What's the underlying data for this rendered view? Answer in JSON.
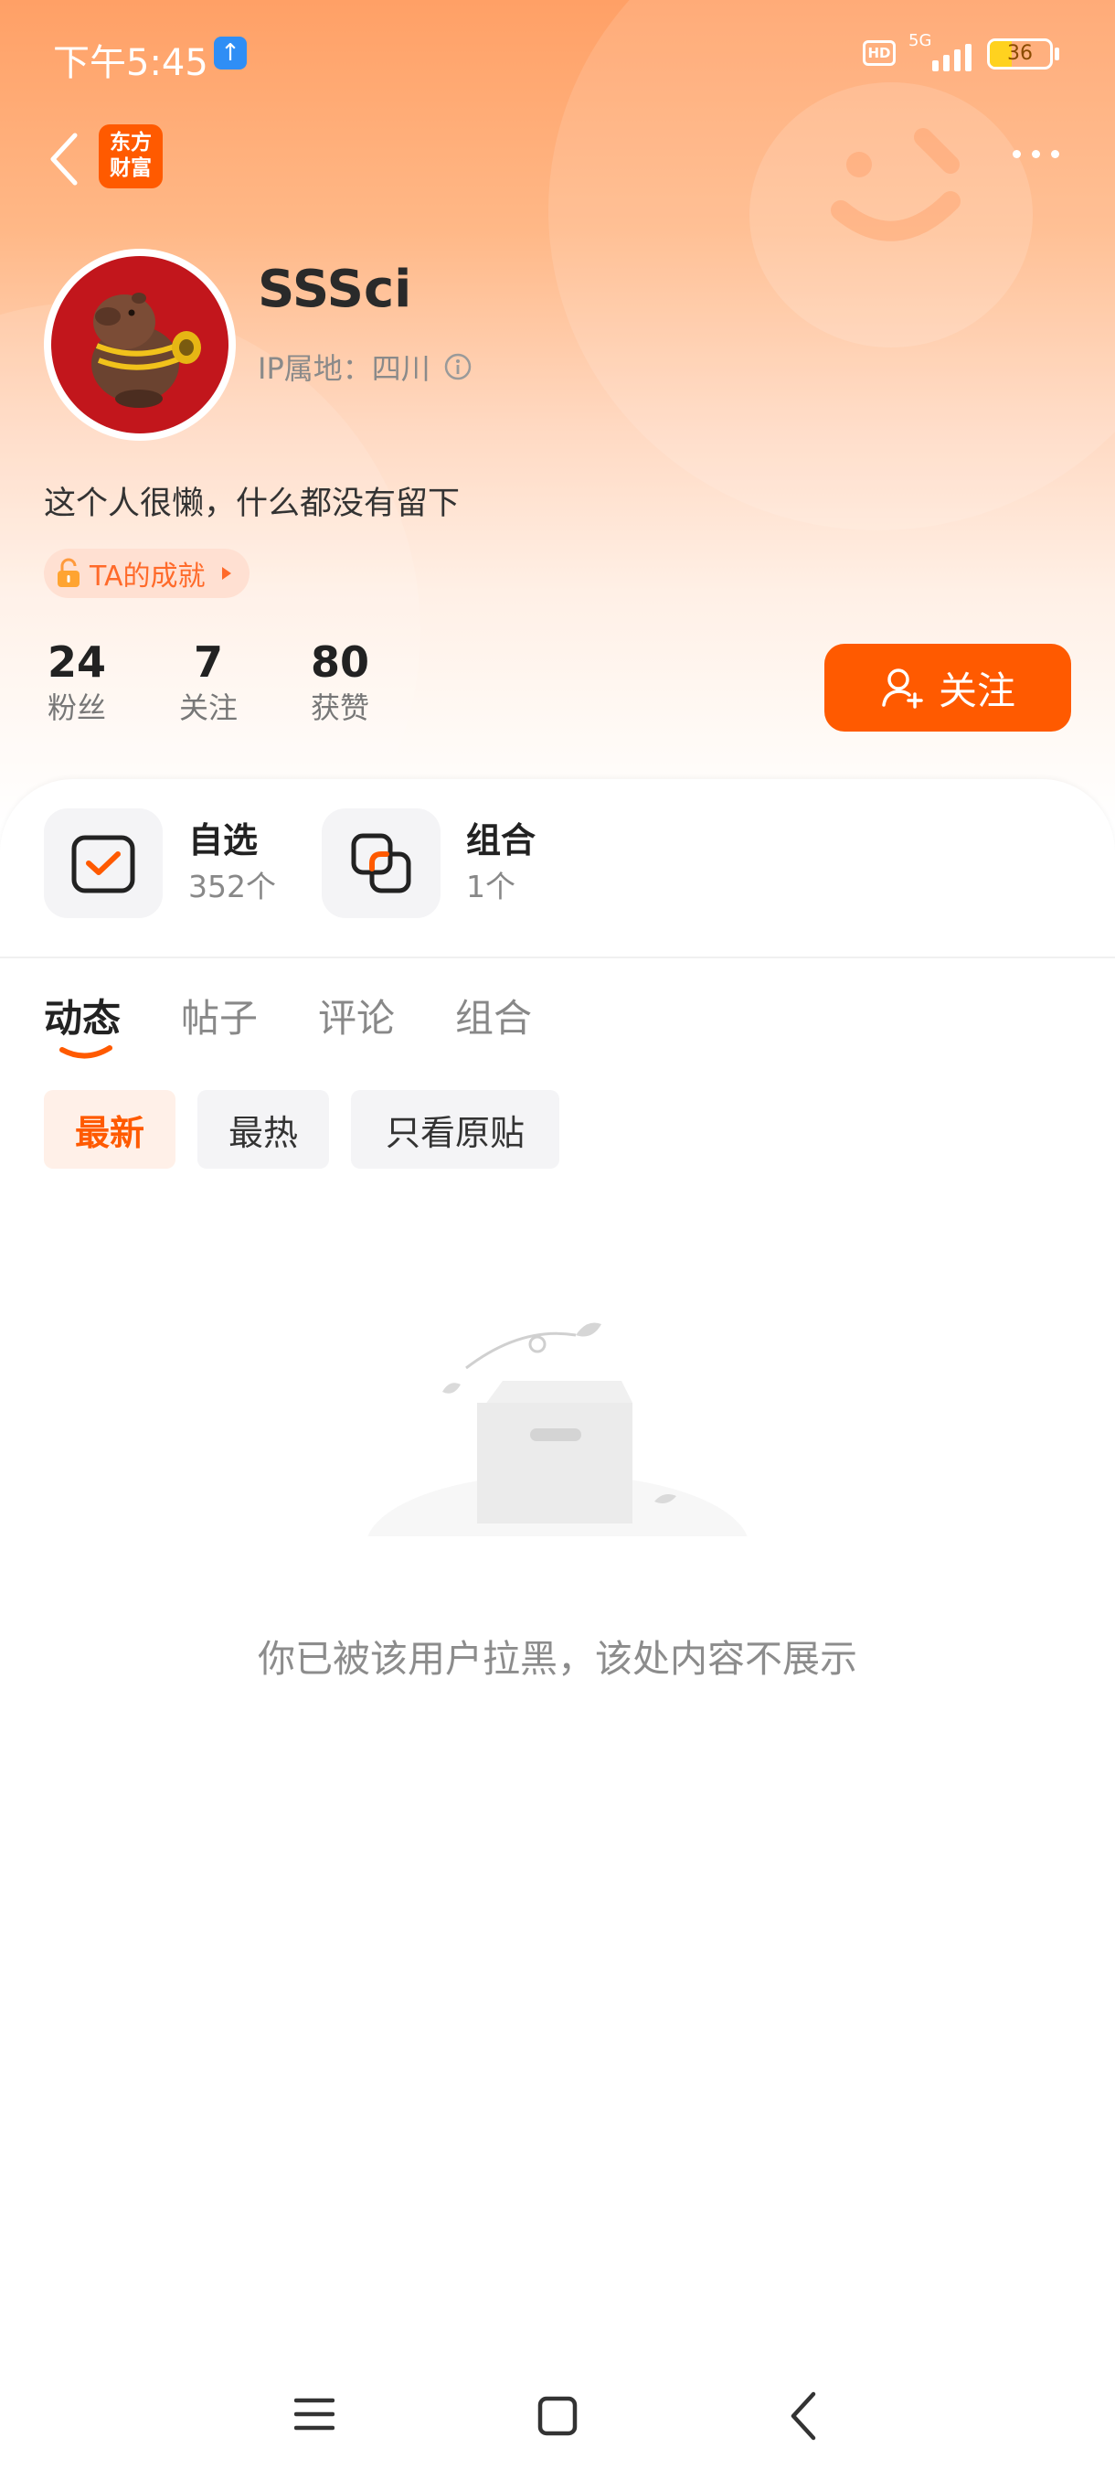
{
  "status_bar": {
    "time": "下午5:45",
    "network": "5G",
    "battery": "36",
    "battery_level_percent": 36,
    "hd": "HD"
  },
  "header": {
    "logo_text": "东方\n财富",
    "logo_line1": "东方",
    "logo_line2": "财富",
    "brand_color": "#ff5a00",
    "back_icon": "chevron-left-icon",
    "more_icon": "more-dots-icon"
  },
  "profile": {
    "username": "SSSci",
    "ip_location": "IP属地：四川",
    "bio": "这个人很懒，什么都没有留下",
    "achievement_label": "TA的成就",
    "stats": [
      {
        "value": "24",
        "label": "粉丝"
      },
      {
        "value": "7",
        "label": "关注"
      },
      {
        "value": "80",
        "label": "获赞"
      }
    ],
    "follow_button_label": "关注"
  },
  "quick_links": [
    {
      "title": "自选",
      "subtitle": "352个",
      "icon": "watchlist-check-icon"
    },
    {
      "title": "组合",
      "subtitle": "1个",
      "icon": "portfolio-icon"
    }
  ],
  "tabs": [
    {
      "label": "动态",
      "active": true
    },
    {
      "label": "帖子",
      "active": false
    },
    {
      "label": "评论",
      "active": false
    },
    {
      "label": "组合",
      "active": false
    }
  ],
  "filters": [
    {
      "label": "最新",
      "active": true
    },
    {
      "label": "最热",
      "active": false
    },
    {
      "label": "只看原贴",
      "active": false
    }
  ],
  "empty_state": {
    "message": "你已被该用户拉黑，该处内容不展示",
    "icon": "empty-box-icon"
  },
  "system_nav": {
    "menu_icon": "menu-icon",
    "home_icon": "home-square-icon",
    "back_icon": "back-chevron-icon"
  },
  "colors": {
    "accent": "#ff5a00",
    "header_gradient_top": "#ffa066",
    "muted_text": "#8c8c8c"
  }
}
